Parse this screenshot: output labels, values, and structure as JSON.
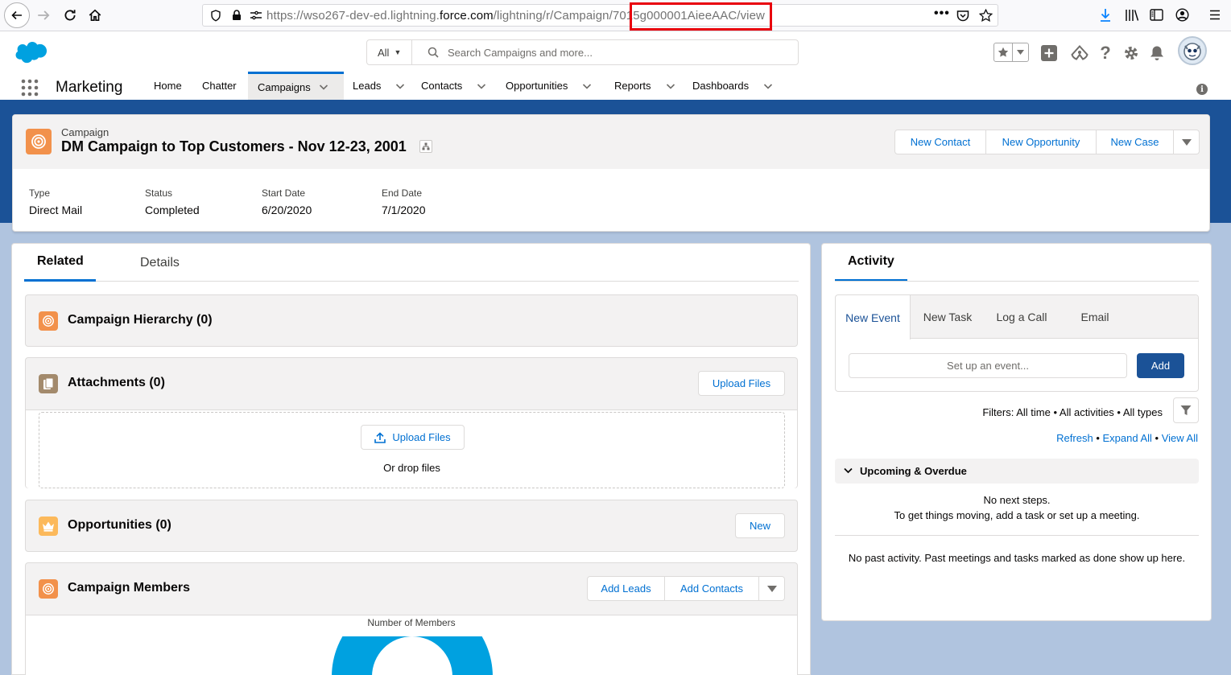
{
  "browser": {
    "url_prefix": "https://wso267-dev-ed.lightning.",
    "url_domain": "force.com",
    "url_suffix": "/lightning/r/Campaign/7015g000001AieeAAC/view"
  },
  "global_header": {
    "search_scope": "All",
    "search_placeholder": "Search Campaigns and more..."
  },
  "nav": {
    "app_name": "Marketing",
    "items": [
      {
        "label": "Home"
      },
      {
        "label": "Chatter"
      },
      {
        "label": "Campaigns"
      },
      {
        "label": "Leads"
      },
      {
        "label": "Contacts"
      },
      {
        "label": "Opportunities"
      },
      {
        "label": "Reports"
      },
      {
        "label": "Dashboards"
      }
    ]
  },
  "record": {
    "object_label": "Campaign",
    "title": "DM Campaign to Top Customers - Nov 12-23, 2001",
    "actions": [
      "New Contact",
      "New Opportunity",
      "New Case"
    ],
    "highlights": [
      {
        "label": "Type",
        "value": "Direct Mail"
      },
      {
        "label": "Status",
        "value": "Completed"
      },
      {
        "label": "Start Date",
        "value": "6/20/2020"
      },
      {
        "label": "End Date",
        "value": "7/1/2020"
      }
    ]
  },
  "tabs": {
    "related": "Related",
    "details": "Details"
  },
  "related": {
    "hierarchy_title": "Campaign Hierarchy (0)",
    "attachments_title": "Attachments (0)",
    "upload_files": "Upload Files",
    "drop_text": "Or drop files",
    "opportunities_title": "Opportunities (0)",
    "new_label": "New",
    "members_title": "Campaign Members",
    "add_leads": "Add Leads",
    "add_contacts": "Add Contacts",
    "chart_title": "Number of Members"
  },
  "activity": {
    "tab": "Activity",
    "publisher_tabs": [
      "New Event",
      "New Task",
      "Log a Call",
      "Email"
    ],
    "event_placeholder": "Set up an event...",
    "add_label": "Add",
    "filters": "Filters: All time • All activities • All types",
    "refresh": "Refresh",
    "expand_all": "Expand All",
    "view_all": "View All",
    "sep": " • ",
    "upcoming_title": "Upcoming & Overdue",
    "no_next_steps": "No next steps.",
    "get_moving": "To get things moving, add a task or set up a meeting.",
    "no_past": "No past activity. Past meetings and tasks marked as done show up here."
  },
  "colors": {
    "brand": "#1b5297",
    "link": "#0070d2",
    "campaign_icon": "#f2914b",
    "attachment_icon": "#a38a6c",
    "opportunity_icon": "#fcb95b",
    "chart_blue": "#00a1e0"
  }
}
